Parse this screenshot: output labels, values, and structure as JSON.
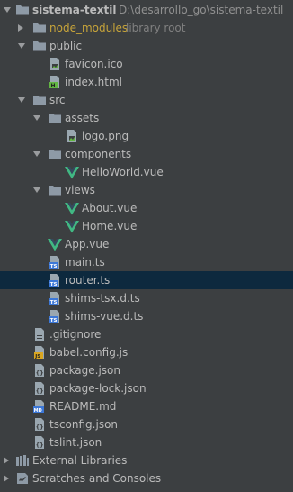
{
  "project": {
    "name": "sistema-textil",
    "path": "D:\\desarrollo_go\\sistema-textil"
  },
  "tree": {
    "node_modules": {
      "label": "node_modules",
      "note": "library root"
    },
    "public": "public",
    "favicon": "favicon.ico",
    "index_html": "index.html",
    "src": "src",
    "assets": "assets",
    "logo": "logo.png",
    "components": "components",
    "helloworld": "HelloWorld.vue",
    "views": "views",
    "about": "About.vue",
    "home": "Home.vue",
    "app_vue": "App.vue",
    "main_ts": "main.ts",
    "router_ts": "router.ts",
    "shims_tsx": "shims-tsx.d.ts",
    "shims_vue": "shims-vue.d.ts",
    "gitignore": ".gitignore",
    "babel_config": "babel.config.js",
    "package_json": "package.json",
    "package_lock": "package-lock.json",
    "readme": "README.md",
    "tsconfig": "tsconfig.json",
    "tslint": "tslint.json",
    "external_libraries": "External Libraries",
    "scratches": "Scratches and Consoles"
  },
  "colors": {
    "background": "#3c3f41",
    "selection": "#0d293e",
    "folder": "#8e9aa6",
    "node_modules_text": "#c7a43a",
    "vue_green": "#41b883",
    "ts_blue": "#3c78d8"
  }
}
